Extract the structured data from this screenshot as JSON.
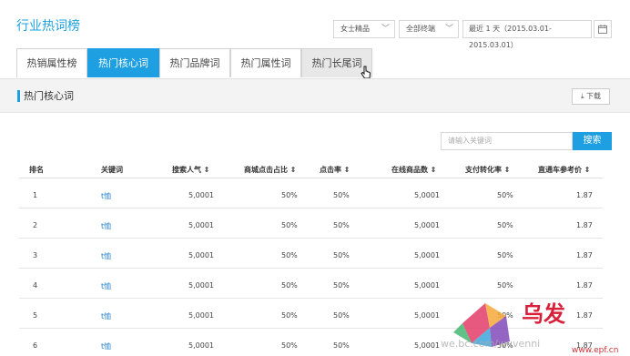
{
  "page": {
    "title": "行业热词榜"
  },
  "filters": {
    "category": "女士精品",
    "terminal": "全部终端",
    "date_range": "最近 1 天（2015.03.01-2015.03.01）",
    "chevron": "﹀",
    "calendar_icon": "calendar-icon"
  },
  "tabs": [
    "热销属性榜",
    "热门核心词",
    "热门品牌词",
    "热门属性词",
    "热门长尾词"
  ],
  "section": {
    "title": "热门核心词",
    "download_label": "⤓ 下载"
  },
  "search": {
    "placeholder": "请输入关键词",
    "button_label": "搜索"
  },
  "table": {
    "headers": [
      "排名",
      "关键词",
      "搜索人气 ⇕",
      "商城点击占比 ⇕",
      "点击率 ⇕",
      "在线商品数 ⇕",
      "支付转化率 ⇕",
      "直通车参考价 ⇕"
    ],
    "rows": [
      [
        "1",
        "t恤",
        "5,0001",
        "50%",
        "50%",
        "5,0001",
        "50%",
        "1.87"
      ],
      [
        "2",
        "t恤",
        "5,0001",
        "50%",
        "50%",
        "5,0001",
        "50%",
        "1.87"
      ],
      [
        "3",
        "t恤",
        "5,0001",
        "50%",
        "50%",
        "5,0001",
        "50%",
        "1.87"
      ],
      [
        "4",
        "t恤",
        "5,0001",
        "50%",
        "50%",
        "5,0001",
        "50%",
        "1.87"
      ],
      [
        "5",
        "t恤",
        "5,0001",
        "50%",
        "50%",
        "5,0001",
        "50%",
        "1.87"
      ],
      [
        "6",
        "t恤",
        "5,0001",
        "50%",
        "50%",
        "5,0001",
        "50%",
        "1.87"
      ]
    ]
  },
  "watermark": {
    "line1": "乌发",
    "line2": "we.bc.com/wuvenni",
    "line3": "www.epf.cn"
  },
  "colors": {
    "accent": "#1e9fe2",
    "title": "#1ea1e0"
  }
}
